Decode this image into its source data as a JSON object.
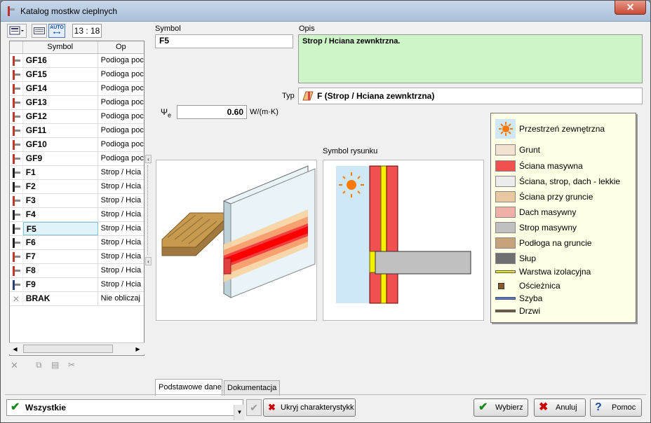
{
  "window": {
    "title": "Katalog mostkw cieplnych",
    "close_label": "✕"
  },
  "toolbar": {
    "time": "13 : 18",
    "auto_label": "AUTO"
  },
  "list": {
    "col_symbol": "Symbol",
    "col_opis": "Op",
    "selected_index": 12,
    "rows": [
      {
        "symbol": "GF16",
        "opis": "Podioga poc",
        "color": "#c0392b"
      },
      {
        "symbol": "GF15",
        "opis": "Podioga poc",
        "color": "#c0392b"
      },
      {
        "symbol": "GF14",
        "opis": "Podioga poc",
        "color": "#c0392b"
      },
      {
        "symbol": "GF13",
        "opis": "Podioga poc",
        "color": "#c0392b"
      },
      {
        "symbol": "GF12",
        "opis": "Podioga poc",
        "color": "#c0392b"
      },
      {
        "symbol": "GF11",
        "opis": "Podioga poc",
        "color": "#c0392b"
      },
      {
        "symbol": "GF10",
        "opis": "Podioga poc",
        "color": "#c0392b"
      },
      {
        "symbol": "GF9",
        "opis": "Podioga poc",
        "color": "#c0392b"
      },
      {
        "symbol": "F1",
        "opis": "Strop / Hcia",
        "color": "#222222"
      },
      {
        "symbol": "F2",
        "opis": "Strop / Hcia",
        "color": "#222222"
      },
      {
        "symbol": "F3",
        "opis": "Strop / Hcia",
        "color": "#c0392b"
      },
      {
        "symbol": "F4",
        "opis": "Strop / Hcia",
        "color": "#222222"
      },
      {
        "symbol": "F5",
        "opis": "Strop / Hcia",
        "color": "#222222"
      },
      {
        "symbol": "F6",
        "opis": "Strop / Hcia",
        "color": "#222222"
      },
      {
        "symbol": "F7",
        "opis": "Strop / Hcia",
        "color": "#c0392b"
      },
      {
        "symbol": "F8",
        "opis": "Strop / Hcia",
        "color": "#c0392b"
      },
      {
        "symbol": "F9",
        "opis": "Strop / Hcia",
        "color": "#2c3e80"
      },
      {
        "symbol": "BRAK",
        "opis": "Nie obliczaj ",
        "color": "#999999"
      }
    ]
  },
  "form": {
    "symbol_label": "Symbol",
    "symbol_value": "F5",
    "opis_label": "Opis",
    "opis_value": "Strop / Hciana zewnktrzna.",
    "typ_label": "Typ",
    "typ_value": "F (Strop / Hciana zewnktrzna)",
    "psi_label": "Ψ",
    "psi_sub": "e",
    "psi_value": "0.60",
    "psi_unit": "W/(m·K)",
    "symbol_rysunku_label": "Symbol rysunku"
  },
  "legend": [
    {
      "label": "Przestrzeń zewnętrzna",
      "color": "#cfe8f8",
      "kind": "sun"
    },
    {
      "label": "Grunt",
      "color": "#f2e2cf",
      "kind": "box"
    },
    {
      "label": "Ściana masywna",
      "color": "#f05050",
      "kind": "box"
    },
    {
      "label": "Ściana, strop, dach - lekkie",
      "color": "#ececec",
      "kind": "box"
    },
    {
      "label": "Ściana przy gruncie",
      "color": "#e8c8a0",
      "kind": "box"
    },
    {
      "label": "Dach masywny",
      "color": "#f0b0a8",
      "kind": "box"
    },
    {
      "label": "Strop masywny",
      "color": "#c0c0c0",
      "kind": "box"
    },
    {
      "label": "Podłoga na gruncie",
      "color": "#c8a27a",
      "kind": "box"
    },
    {
      "label": "Słup",
      "color": "#707070",
      "kind": "box"
    },
    {
      "label": "Warstwa izolacyjna",
      "color": "#f5f000",
      "kind": "line"
    },
    {
      "label": "Ościeżnica",
      "color": "#8b5a2b",
      "kind": "small"
    },
    {
      "label": "Szyba",
      "color": "#4a78e0",
      "kind": "line"
    },
    {
      "label": "Drzwi",
      "color": "#7a5a3a",
      "kind": "line"
    }
  ],
  "tabs": [
    {
      "label": "Podstawowe dane",
      "active": true
    },
    {
      "label": "Dokumentacja",
      "active": false
    }
  ],
  "bottom": {
    "filter_value": "Wszystkie",
    "hide_button": "Ukryj charakterystykk",
    "select_button": "Wybierz",
    "cancel_button": "Anuluj",
    "help_button": "Pomoc"
  }
}
